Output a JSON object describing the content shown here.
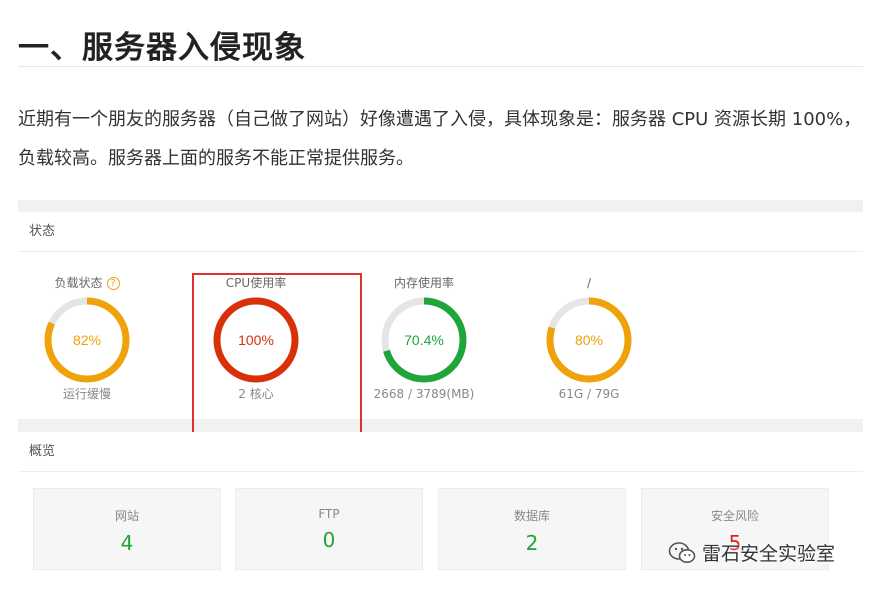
{
  "article": {
    "title": "一、服务器入侵现象",
    "paragraph": "近期有一个朋友的服务器（自己做了网站）好像遭遇了入侵，具体现象是：服务器 CPU 资源长期 100%，负载较高。服务器上面的服务不能正常提供服务。"
  },
  "status_card": {
    "header": "状态",
    "gauges": [
      {
        "title": "负载状态",
        "help": "?",
        "value_text": "82%",
        "percent": 82,
        "sub": "运行缓慢",
        "color": "#f0a20b",
        "text_color": "#f0a20b"
      },
      {
        "title": "CPU使用率",
        "help": "",
        "value_text": "100%",
        "percent": 100,
        "sub": "2 核心",
        "color": "#d9300a",
        "text_color": "#d9300a"
      },
      {
        "title": "内存使用率",
        "help": "",
        "value_text": "70.4%",
        "percent": 70.4,
        "sub": "2668 / 3789(MB)",
        "color": "#20a53a",
        "text_color": "#20a53a"
      },
      {
        "title": "/",
        "help": "",
        "value_text": "80%",
        "percent": 80,
        "sub": "61G / 79G",
        "color": "#f0a20b",
        "text_color": "#f0a20b"
      }
    ]
  },
  "overview_card": {
    "header": "概览",
    "stats": [
      {
        "label": "网站",
        "value": "4"
      },
      {
        "label": "FTP",
        "value": "0"
      },
      {
        "label": "数据库",
        "value": "2"
      },
      {
        "label": "安全风险",
        "value": "5"
      }
    ]
  },
  "watermark": {
    "text": "雷石安全实验室",
    "icon": "wechat-icon"
  },
  "colors": {
    "ok": "#20a53a",
    "warn": "#f0a20b",
    "danger": "#d9300a",
    "track": "#e5e5e5",
    "highlight": "#e03030"
  }
}
